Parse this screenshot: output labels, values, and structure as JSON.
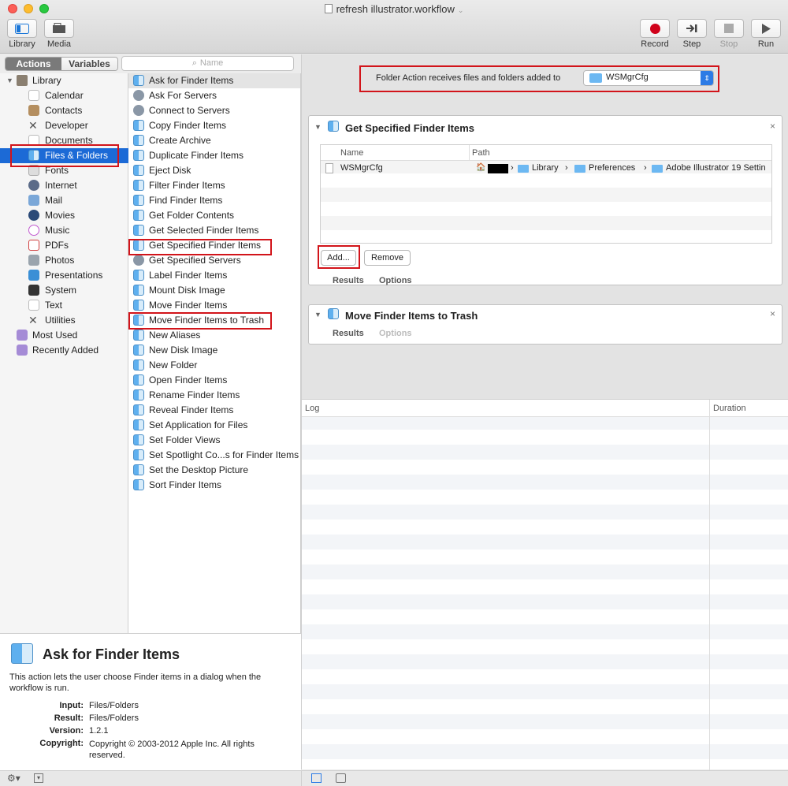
{
  "window": {
    "title": "refresh illustrator.workflow"
  },
  "toolbar": {
    "library_label": "Library",
    "media_label": "Media",
    "record_label": "Record",
    "step_label": "Step",
    "stop_label": "Stop",
    "run_label": "Run"
  },
  "tabs": {
    "actions": "Actions",
    "variables": "Variables"
  },
  "search": {
    "placeholder": "Name"
  },
  "library": {
    "items": [
      {
        "label": "Library"
      },
      {
        "label": "Calendar"
      },
      {
        "label": "Contacts"
      },
      {
        "label": "Developer"
      },
      {
        "label": "Documents"
      },
      {
        "label": "Files & Folders"
      },
      {
        "label": "Fonts"
      },
      {
        "label": "Internet"
      },
      {
        "label": "Mail"
      },
      {
        "label": "Movies"
      },
      {
        "label": "Music"
      },
      {
        "label": "PDFs"
      },
      {
        "label": "Photos"
      },
      {
        "label": "Presentations"
      },
      {
        "label": "System"
      },
      {
        "label": "Text"
      },
      {
        "label": "Utilities"
      },
      {
        "label": "Most Used"
      },
      {
        "label": "Recently Added"
      }
    ]
  },
  "actions": {
    "items": [
      {
        "label": "Ask for Finder Items"
      },
      {
        "label": "Ask For Servers"
      },
      {
        "label": "Connect to Servers"
      },
      {
        "label": "Copy Finder Items"
      },
      {
        "label": "Create Archive"
      },
      {
        "label": "Duplicate Finder Items"
      },
      {
        "label": "Eject Disk"
      },
      {
        "label": "Filter Finder Items"
      },
      {
        "label": "Find Finder Items"
      },
      {
        "label": "Get Folder Contents"
      },
      {
        "label": "Get Selected Finder Items"
      },
      {
        "label": "Get Specified Finder Items"
      },
      {
        "label": "Get Specified Servers"
      },
      {
        "label": "Label Finder Items"
      },
      {
        "label": "Mount Disk Image"
      },
      {
        "label": "Move Finder Items"
      },
      {
        "label": "Move Finder Items to Trash"
      },
      {
        "label": "New Aliases"
      },
      {
        "label": "New Disk Image"
      },
      {
        "label": "New Folder"
      },
      {
        "label": "Open Finder Items"
      },
      {
        "label": "Rename Finder Items"
      },
      {
        "label": "Reveal Finder Items"
      },
      {
        "label": "Set Application for Files"
      },
      {
        "label": "Set Folder Views"
      },
      {
        "label": "Set Spotlight Co...s for Finder Items"
      },
      {
        "label": "Set the Desktop Picture"
      },
      {
        "label": "Sort Finder Items"
      }
    ]
  },
  "description": {
    "title": "Ask for Finder Items",
    "body": "This action lets the user choose Finder items in a dialog when the workflow is run.",
    "input_label": "Input:",
    "input_value": "Files/Folders",
    "result_label": "Result:",
    "result_value": "Files/Folders",
    "version_label": "Version:",
    "version_value": "1.2.1",
    "copyright_label": "Copyright:",
    "copyright_value": "Copyright © 2003-2012 Apple Inc.  All rights reserved."
  },
  "folder_action": {
    "label": "Folder Action receives files and folders added to",
    "folder": "WSMgrCfg"
  },
  "card1": {
    "title": "Get Specified Finder Items",
    "col_name": "Name",
    "col_path": "Path",
    "row_name": "WSMgrCfg",
    "path": [
      "Library",
      "Preferences",
      "Adobe Illustrator 19 Settin"
    ],
    "add_label": "Add...",
    "remove_label": "Remove",
    "results_label": "Results",
    "options_label": "Options"
  },
  "card2": {
    "title": "Move Finder Items to Trash",
    "results_label": "Results",
    "options_label": "Options"
  },
  "log": {
    "col_log": "Log",
    "col_duration": "Duration"
  },
  "colors": {
    "highlight_red": "#d2141a",
    "selection_blue": "#1c6ad6"
  }
}
